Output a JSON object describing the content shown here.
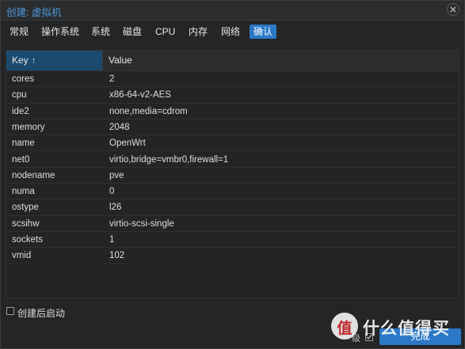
{
  "window": {
    "title": "创建: 虚拟机"
  },
  "tabs": [
    {
      "label": "常规",
      "active": false
    },
    {
      "label": "操作系统",
      "active": false
    },
    {
      "label": "系统",
      "active": false
    },
    {
      "label": "磁盘",
      "active": false
    },
    {
      "label": "CPU",
      "active": false
    },
    {
      "label": "内存",
      "active": false
    },
    {
      "label": "网络",
      "active": false
    },
    {
      "label": "确认",
      "active": true
    }
  ],
  "grid": {
    "columns": {
      "key": "Key",
      "value": "Value",
      "sort": "ascending"
    },
    "rows": [
      {
        "key": "cores",
        "value": "2"
      },
      {
        "key": "cpu",
        "value": "x86-64-v2-AES"
      },
      {
        "key": "ide2",
        "value": "none,media=cdrom"
      },
      {
        "key": "memory",
        "value": "2048"
      },
      {
        "key": "name",
        "value": "OpenWrt"
      },
      {
        "key": "net0",
        "value": "virtio,bridge=vmbr0,firewall=1"
      },
      {
        "key": "nodename",
        "value": "pve"
      },
      {
        "key": "numa",
        "value": "0"
      },
      {
        "key": "ostype",
        "value": "l26"
      },
      {
        "key": "scsihw",
        "value": "virtio-scsi-single"
      },
      {
        "key": "sockets",
        "value": "1"
      },
      {
        "key": "vmid",
        "value": "102"
      }
    ]
  },
  "footer": {
    "start_after_create_label": "创建后启动",
    "start_after_create_checked": false,
    "advanced_label": "级",
    "advanced_checked": true,
    "finish_label": "完成"
  },
  "watermark": {
    "logo_char": "值",
    "text": "什么值得买"
  },
  "colors": {
    "accent": "#2b78c6",
    "title": "#4d9be0",
    "background": "#242526",
    "header_key_bg": "#1b4a6e"
  },
  "icons": {
    "close": "close-icon",
    "sort": "sort-ascending-icon",
    "check": "checkmark-icon"
  }
}
